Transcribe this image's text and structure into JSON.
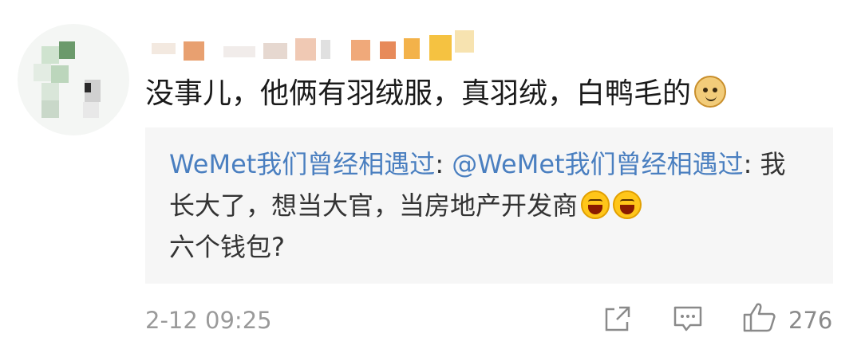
{
  "comment": {
    "text": "没事儿，他俩有羽绒服，真羽绒，白鸭毛的",
    "emoji": "doge-emoji"
  },
  "quote": {
    "author": "WeMet我们曾经相遇过",
    "separator": ": ",
    "mention": "@WeMet我们曾经相遇过",
    "body": ": 我长大了，想当大官，当房地产开发商",
    "emojis": [
      "laugh-emoji",
      "laugh-emoji"
    ],
    "tail": "六个钱包?"
  },
  "footer": {
    "time": "2-12 09:25",
    "like_count": "276",
    "icons": [
      "share-icon",
      "comment-icon",
      "thumbs-up-icon"
    ]
  },
  "colors": {
    "link": "#4a7fc0",
    "quote_bg": "#f6f6f6",
    "meta": "#9a9a9a"
  }
}
